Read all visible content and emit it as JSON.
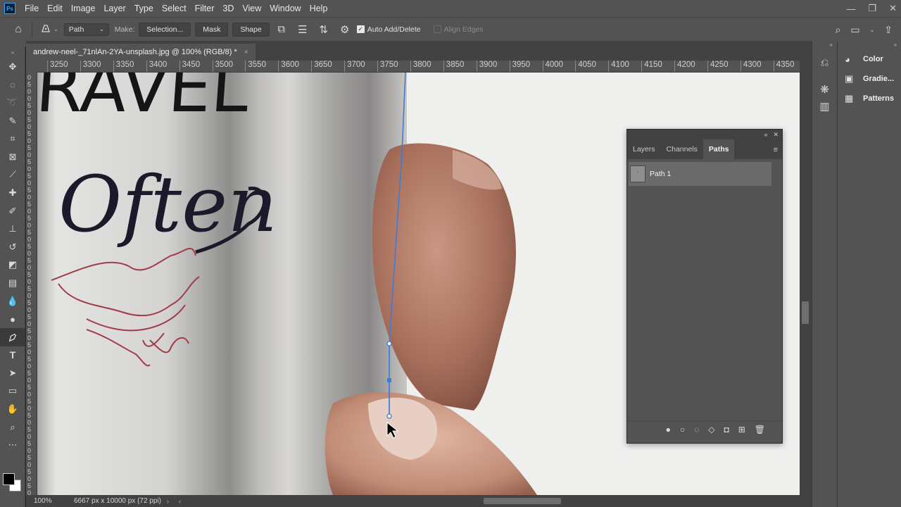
{
  "app": {
    "logo_text": "Ps"
  },
  "menu": [
    "File",
    "Edit",
    "Image",
    "Layer",
    "Type",
    "Select",
    "Filter",
    "3D",
    "View",
    "Window",
    "Help"
  ],
  "window_controls": {
    "minimize": "—",
    "restore": "❐",
    "close": "✕"
  },
  "options": {
    "mode_value": "Path",
    "make_label": "Make:",
    "selection_btn": "Selection...",
    "mask_btn": "Mask",
    "shape_btn": "Shape",
    "auto_add_delete": "Auto Add/Delete",
    "align_edges": "Align Edges"
  },
  "document": {
    "tab_title": "andrew-neel-_71nlAn-2YA-unsplash.jpg @ 100% (RGB/8) *",
    "close_glyph": "×"
  },
  "ruler": {
    "top_ticks": [
      "3250",
      "3300",
      "3350",
      "3400",
      "3450",
      "3500",
      "3550",
      "3600",
      "3650",
      "3700",
      "3750",
      "3800",
      "3850",
      "3900",
      "3950",
      "4000",
      "4050",
      "4100",
      "4150",
      "4200",
      "4250",
      "4300",
      "4350"
    ],
    "left_digits": [
      "0",
      "5",
      "0",
      "0",
      "5",
      "0",
      "5",
      "0",
      "5",
      "0",
      "5",
      "0",
      "5",
      "0",
      "5",
      "0",
      "5",
      "0",
      "5",
      "0",
      "5",
      "0",
      "5",
      "0",
      "5",
      "0",
      "5",
      "0",
      "5",
      "0",
      "5",
      "0",
      "5",
      "0",
      "5",
      "0",
      "5",
      "0",
      "5",
      "0",
      "5",
      "0",
      "5",
      "0",
      "5",
      "0",
      "5",
      "0",
      "5",
      "0",
      "5",
      "0",
      "5",
      "0",
      "5",
      "0",
      "5",
      "0",
      "5",
      "0"
    ]
  },
  "status": {
    "zoom": "100%",
    "doc_info": "6667 px x 10000 px (72 ppi)"
  },
  "dock": {
    "panels": [
      "Color",
      "Gradie...",
      "Patterns"
    ]
  },
  "paths_panel": {
    "tabs": [
      "Layers",
      "Channels",
      "Paths"
    ],
    "active_tab": "Paths",
    "rows": [
      "Path 1"
    ]
  },
  "canvas_art": {
    "lettering_top": "RAVEL",
    "lettering_script": "Often"
  },
  "colors": {
    "foreground": "#000000",
    "background": "#ffffff",
    "path_stroke": "#3d7cd8"
  }
}
